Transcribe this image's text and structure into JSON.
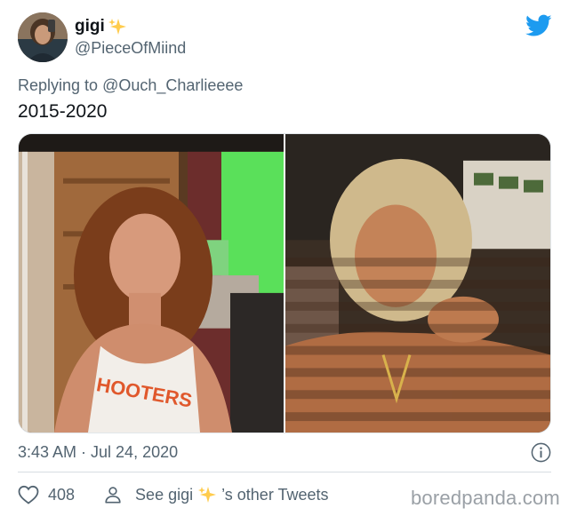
{
  "author": {
    "display_name": "gigi",
    "handle": "@PieceOfMiind",
    "avatar_icon": "profile-photo",
    "sparkle_icon": "sparkles-emoji"
  },
  "reply": {
    "prefix": "Replying to",
    "mention": "@Ouch_Charlieeee"
  },
  "tweet": {
    "text": "2015-2020"
  },
  "media": {
    "photos": [
      {
        "label": "left-photo",
        "printed_text": "HOOTERS"
      },
      {
        "label": "right-photo"
      }
    ]
  },
  "meta": {
    "timestamp": "3:43 AM · Jul 24, 2020",
    "info_icon": "info-icon"
  },
  "actions": {
    "likes_count": "408",
    "profile_link_prefix": "See gigi",
    "profile_link_suffix": "’s other Tweets"
  },
  "colors": {
    "twitter_blue": "#1d9bf0",
    "secondary_text": "#536471",
    "primary_text": "#0f1419"
  },
  "watermark": "boredpanda.com"
}
